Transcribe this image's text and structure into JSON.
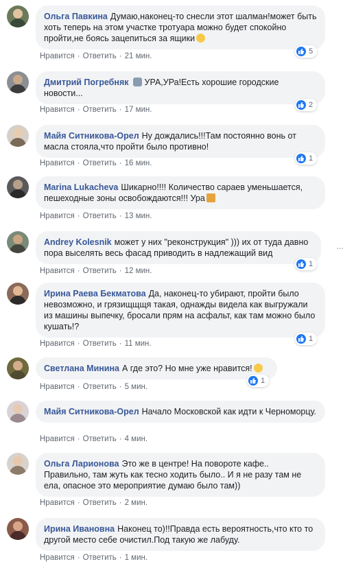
{
  "comments": [
    {
      "author": "Ольга Павкина",
      "text": "Думаю,наконец-то снесли этот шалман!может быть хоть теперь на этом участке тротуара можно будет спокойно пройти,не боясь зацепиться за ящики",
      "like": "Нравится",
      "reply": "Ответить",
      "time": "21 мин.",
      "reactions": "5",
      "emoji": "grinning-sweat-emoji",
      "emoji_color": "#f7c948"
    },
    {
      "author": "Дмитрий Погребняк",
      "text": "УРА,УРа!Есть хорошие городские новости...",
      "like": "Нравится",
      "reply": "Ответить",
      "time": "17 мин.",
      "reactions": "2",
      "emoji": "speech-bubble-emoji",
      "emoji_color": "#8a9bb0"
    },
    {
      "author": "Майя Ситникова-Орел",
      "text": "Ну дождались!!!Там постоянно вонь от масла стояла,что пройти было противно!",
      "like": "Нравится",
      "reply": "Ответить",
      "time": "16 мин.",
      "reactions": "1"
    },
    {
      "author": "Marina Lukacheva",
      "text": "Шикарно!!!! Количество сараев уменьшается, пешеходные зоны освобождаются!!! Ура",
      "like": "Нравится",
      "reply": "Ответить",
      "time": "13 мин.",
      "emoji": "party-popper-emoji",
      "emoji_color": "#e8a33c"
    },
    {
      "author": "Andrey Kolesnik",
      "text": "может у них \"реконструкция\" ))) их от туда давно пора выселять весь фасад приводить в надлежащий вид",
      "like": "Нравится",
      "reply": "Ответить",
      "time": "12 мин.",
      "reactions": "1"
    },
    {
      "author": "Ирина Раева Бекматова",
      "text": "Да, наконец-то убирают, пройти было невозможно, и грязищщщя такая, однажды видела как выгружали из машины выпечку, бросали прям на асфальт, как там можно было кушать!?",
      "like": "Нравится",
      "reply": "Ответить",
      "time": "11 мин.",
      "reactions": "1"
    },
    {
      "author": "Светлана Минина",
      "text": "А где это? Но мне уже нравится!",
      "like": "Нравится",
      "reply": "Ответить",
      "time": "5 мин.",
      "reactions": "1",
      "emoji": "smiley-emoji",
      "emoji_color": "#f7c948"
    },
    {
      "author": "Майя Ситникова-Орел",
      "text": "Начало Московской как идти к Черноморцу.",
      "like": "Нравится",
      "reply": "Ответить",
      "time": "4 мин."
    },
    {
      "author": "Ольга Ларионова",
      "text": "Это же в центре! На повороте кафе.. Правильно, там жуть как тесно ходить было.. И я не разу там не ела, опасное это мероприятие думаю было там))",
      "like": "Нравится",
      "reply": "Ответить",
      "time": "2 мин."
    },
    {
      "author": "Ирина Ивановна",
      "text": "Наконец то)!!Правда есть вероятность,что кто то другой место себе очистил.Под такую же лабуду.",
      "like": "Нравится",
      "reply": "Ответить",
      "time": "1 мин."
    }
  ],
  "colors": {
    "link": "#385898",
    "bubble": "#f2f3f5",
    "meta": "#606770",
    "like": "#2078f4"
  },
  "icons": {
    "like": "thumbs-up-icon",
    "more": "more-options-icon"
  }
}
